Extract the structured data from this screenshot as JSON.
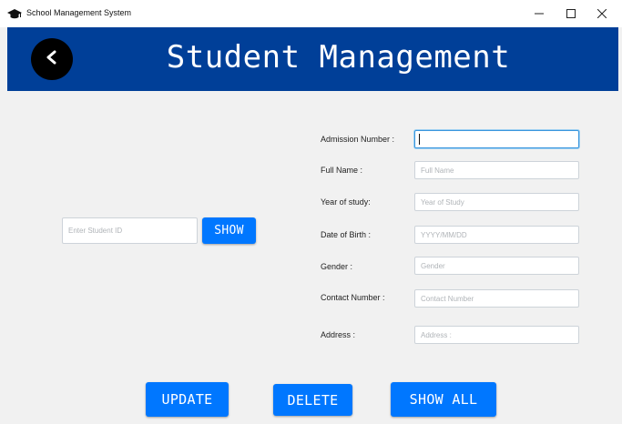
{
  "window": {
    "title": "School Management System",
    "app_icon": "graduation-cap-icon",
    "controls": [
      "minimize-icon",
      "maximize-icon",
      "close-icon"
    ]
  },
  "header": {
    "title": "Student Management",
    "back_icon": "chevron-left-icon",
    "background": "#003f98"
  },
  "search": {
    "placeholder": "Enter Student ID",
    "value": "",
    "show_label": "SHOW"
  },
  "form": {
    "admission_number": {
      "label": "Admission Number :",
      "value": "",
      "placeholder": ""
    },
    "full_name": {
      "label": "Full Name :",
      "value": "",
      "placeholder": "Full Name"
    },
    "year_of_study": {
      "label": "Year of study:",
      "value": "",
      "placeholder": "Year of Study"
    },
    "date_of_birth": {
      "label": "Date of Birth :",
      "value": "",
      "placeholder": "YYYY/MM/DD"
    },
    "gender": {
      "label": "Gender :",
      "value": "",
      "placeholder": "Gender"
    },
    "contact_number": {
      "label": "Contact Number :",
      "value": "",
      "placeholder": "Contact Number"
    },
    "address": {
      "label": "Address :",
      "value": "",
      "placeholder": "Address :"
    }
  },
  "actions": {
    "update_label": "UPDATE",
    "delete_label": "DELETE",
    "show_all_label": "SHOW ALL"
  },
  "colors": {
    "accent": "#0077ff",
    "focus": "#3a96dd"
  }
}
